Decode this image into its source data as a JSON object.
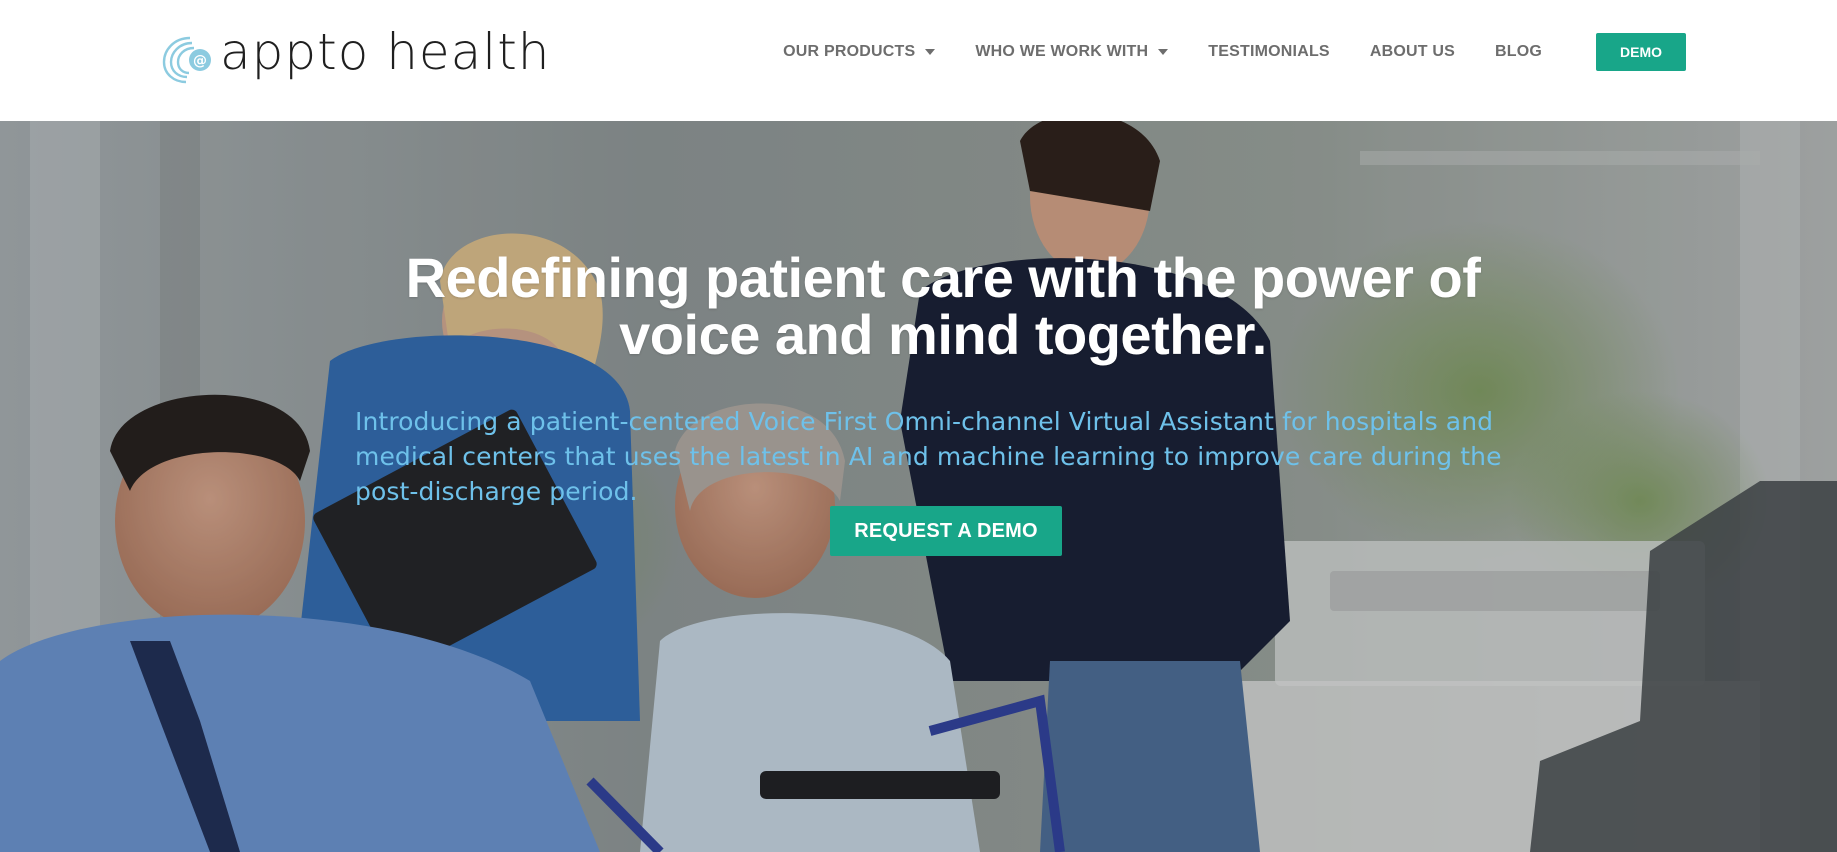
{
  "header": {
    "logo": {
      "text_prefix": "appto",
      "text_suffix": "health",
      "icon": "appto-at-swirl-icon"
    },
    "nav": [
      {
        "label": "OUR PRODUCTS",
        "dropdown": true
      },
      {
        "label": "WHO WE WORK WITH",
        "dropdown": true
      },
      {
        "label": "TESTIMONIALS",
        "dropdown": false
      },
      {
        "label": "ABOUT US",
        "dropdown": false
      },
      {
        "label": "BLOG",
        "dropdown": false
      }
    ],
    "demo_label": "DEMO"
  },
  "hero": {
    "title_line1": "Redefining patient care with the power of",
    "title_line2": "voice and mind together.",
    "subtitle": "Introducing a patient-centered Voice First Omni-channel Virtual Assistant for hospitals and medical centers that uses the latest in AI and machine learning to improve care during the post-discharge period.",
    "cta_label": "REQUEST A DEMO"
  },
  "colors": {
    "accent": "#18a689",
    "subtitle": "#6ec1ea",
    "nav_text": "#6d6d6d",
    "logo_blue": "#7fc6df"
  }
}
